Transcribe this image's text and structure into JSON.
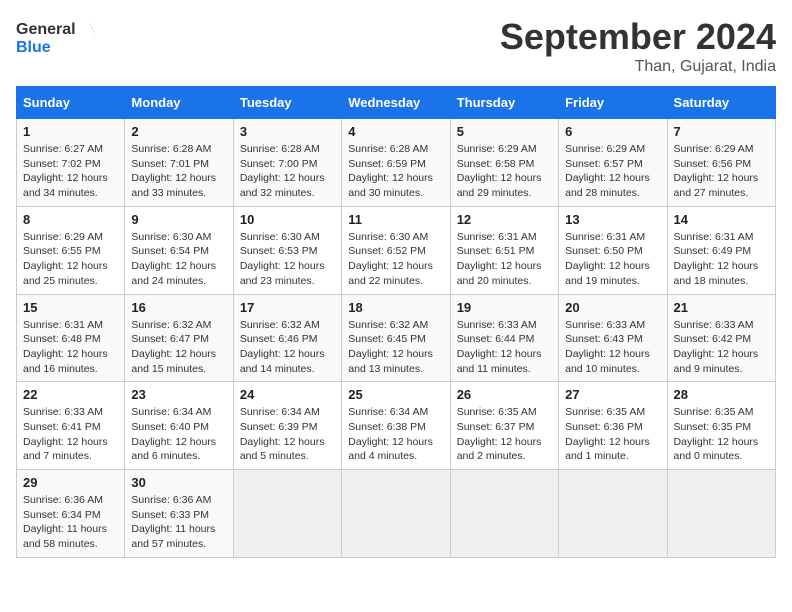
{
  "header": {
    "logo_line1": "General",
    "logo_line2": "Blue",
    "month": "September 2024",
    "location": "Than, Gujarat, India"
  },
  "days_of_week": [
    "Sunday",
    "Monday",
    "Tuesday",
    "Wednesday",
    "Thursday",
    "Friday",
    "Saturday"
  ],
  "weeks": [
    [
      {
        "day": "1",
        "info": "Sunrise: 6:27 AM\nSunset: 7:02 PM\nDaylight: 12 hours\nand 34 minutes."
      },
      {
        "day": "2",
        "info": "Sunrise: 6:28 AM\nSunset: 7:01 PM\nDaylight: 12 hours\nand 33 minutes."
      },
      {
        "day": "3",
        "info": "Sunrise: 6:28 AM\nSunset: 7:00 PM\nDaylight: 12 hours\nand 32 minutes."
      },
      {
        "day": "4",
        "info": "Sunrise: 6:28 AM\nSunset: 6:59 PM\nDaylight: 12 hours\nand 30 minutes."
      },
      {
        "day": "5",
        "info": "Sunrise: 6:29 AM\nSunset: 6:58 PM\nDaylight: 12 hours\nand 29 minutes."
      },
      {
        "day": "6",
        "info": "Sunrise: 6:29 AM\nSunset: 6:57 PM\nDaylight: 12 hours\nand 28 minutes."
      },
      {
        "day": "7",
        "info": "Sunrise: 6:29 AM\nSunset: 6:56 PM\nDaylight: 12 hours\nand 27 minutes."
      }
    ],
    [
      {
        "day": "8",
        "info": "Sunrise: 6:29 AM\nSunset: 6:55 PM\nDaylight: 12 hours\nand 25 minutes."
      },
      {
        "day": "9",
        "info": "Sunrise: 6:30 AM\nSunset: 6:54 PM\nDaylight: 12 hours\nand 24 minutes."
      },
      {
        "day": "10",
        "info": "Sunrise: 6:30 AM\nSunset: 6:53 PM\nDaylight: 12 hours\nand 23 minutes."
      },
      {
        "day": "11",
        "info": "Sunrise: 6:30 AM\nSunset: 6:52 PM\nDaylight: 12 hours\nand 22 minutes."
      },
      {
        "day": "12",
        "info": "Sunrise: 6:31 AM\nSunset: 6:51 PM\nDaylight: 12 hours\nand 20 minutes."
      },
      {
        "day": "13",
        "info": "Sunrise: 6:31 AM\nSunset: 6:50 PM\nDaylight: 12 hours\nand 19 minutes."
      },
      {
        "day": "14",
        "info": "Sunrise: 6:31 AM\nSunset: 6:49 PM\nDaylight: 12 hours\nand 18 minutes."
      }
    ],
    [
      {
        "day": "15",
        "info": "Sunrise: 6:31 AM\nSunset: 6:48 PM\nDaylight: 12 hours\nand 16 minutes."
      },
      {
        "day": "16",
        "info": "Sunrise: 6:32 AM\nSunset: 6:47 PM\nDaylight: 12 hours\nand 15 minutes."
      },
      {
        "day": "17",
        "info": "Sunrise: 6:32 AM\nSunset: 6:46 PM\nDaylight: 12 hours\nand 14 minutes."
      },
      {
        "day": "18",
        "info": "Sunrise: 6:32 AM\nSunset: 6:45 PM\nDaylight: 12 hours\nand 13 minutes."
      },
      {
        "day": "19",
        "info": "Sunrise: 6:33 AM\nSunset: 6:44 PM\nDaylight: 12 hours\nand 11 minutes."
      },
      {
        "day": "20",
        "info": "Sunrise: 6:33 AM\nSunset: 6:43 PM\nDaylight: 12 hours\nand 10 minutes."
      },
      {
        "day": "21",
        "info": "Sunrise: 6:33 AM\nSunset: 6:42 PM\nDaylight: 12 hours\nand 9 minutes."
      }
    ],
    [
      {
        "day": "22",
        "info": "Sunrise: 6:33 AM\nSunset: 6:41 PM\nDaylight: 12 hours\nand 7 minutes."
      },
      {
        "day": "23",
        "info": "Sunrise: 6:34 AM\nSunset: 6:40 PM\nDaylight: 12 hours\nand 6 minutes."
      },
      {
        "day": "24",
        "info": "Sunrise: 6:34 AM\nSunset: 6:39 PM\nDaylight: 12 hours\nand 5 minutes."
      },
      {
        "day": "25",
        "info": "Sunrise: 6:34 AM\nSunset: 6:38 PM\nDaylight: 12 hours\nand 4 minutes."
      },
      {
        "day": "26",
        "info": "Sunrise: 6:35 AM\nSunset: 6:37 PM\nDaylight: 12 hours\nand 2 minutes."
      },
      {
        "day": "27",
        "info": "Sunrise: 6:35 AM\nSunset: 6:36 PM\nDaylight: 12 hours\nand 1 minute."
      },
      {
        "day": "28",
        "info": "Sunrise: 6:35 AM\nSunset: 6:35 PM\nDaylight: 12 hours\nand 0 minutes."
      }
    ],
    [
      {
        "day": "29",
        "info": "Sunrise: 6:36 AM\nSunset: 6:34 PM\nDaylight: 11 hours\nand 58 minutes."
      },
      {
        "day": "30",
        "info": "Sunrise: 6:36 AM\nSunset: 6:33 PM\nDaylight: 11 hours\nand 57 minutes."
      },
      {
        "day": "",
        "info": ""
      },
      {
        "day": "",
        "info": ""
      },
      {
        "day": "",
        "info": ""
      },
      {
        "day": "",
        "info": ""
      },
      {
        "day": "",
        "info": ""
      }
    ]
  ]
}
